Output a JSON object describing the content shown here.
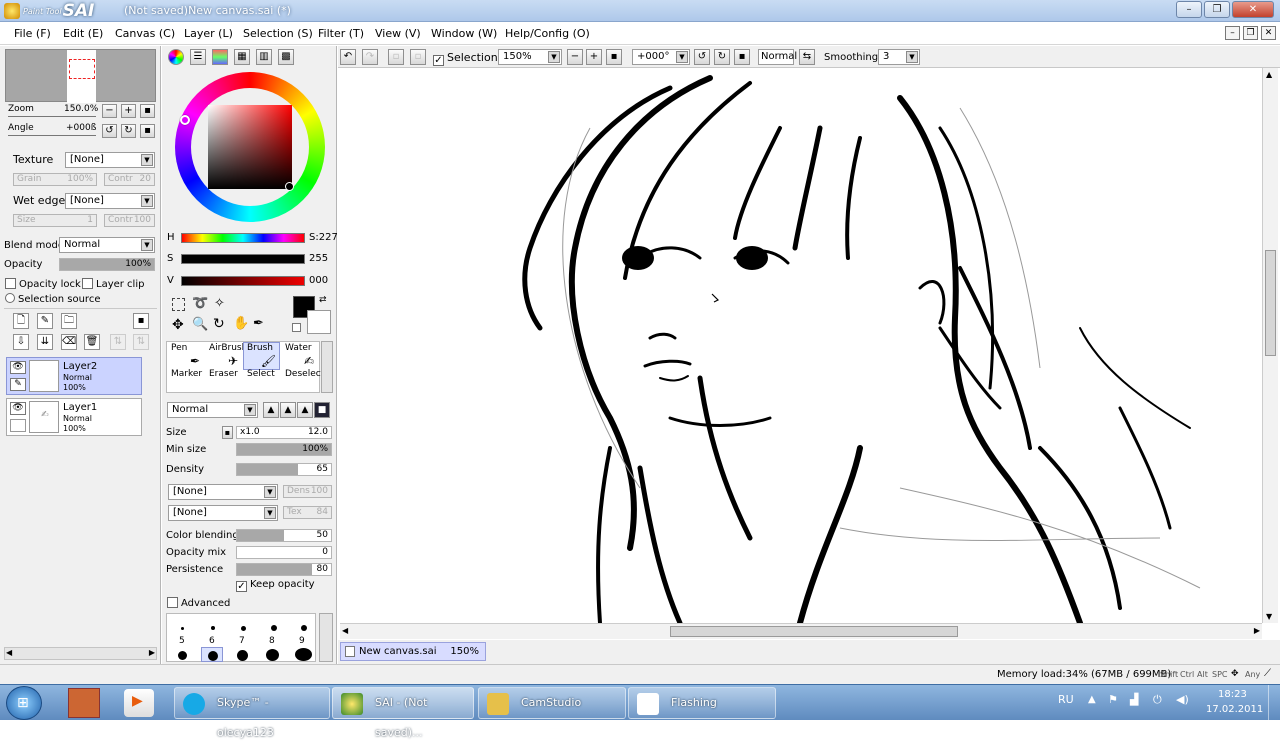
{
  "window": {
    "logo_small": "Paint Tool",
    "logo_big": "SAI",
    "title": "(Not saved)New canvas.sai (*)",
    "controls": [
      "–",
      "❐",
      "✕"
    ]
  },
  "menu": [
    {
      "label": "File (F)"
    },
    {
      "label": "Edit (E)"
    },
    {
      "label": "Canvas (C)"
    },
    {
      "label": "Layer (L)"
    },
    {
      "label": "Selection (S)"
    },
    {
      "label": "Filter (T)"
    },
    {
      "label": "View (V)"
    },
    {
      "label": "Window (W)"
    },
    {
      "label": "Help/Config (O)"
    }
  ],
  "navigator": {
    "zoom_label": "Zoom",
    "zoom_value": "150.0%",
    "angle_label": "Angle",
    "angle_value": "+000ß"
  },
  "left": {
    "texture_label": "Texture",
    "texture_value": "[None]",
    "grain_label": "Grain",
    "grain_value": "100%",
    "contr_label": "Contr",
    "contr_value": "20",
    "wet_label": "Wet edge",
    "wet_value": "[None]",
    "size_label": "Size",
    "size_value": "1",
    "contr2_label": "Contr",
    "contr2_value": "100",
    "blend_label": "Blend mode",
    "blend_value": "Normal",
    "opacity_label": "Opacity",
    "opacity_value": "100%",
    "opacity_fraction": 1.0,
    "opacity_lock": "Opacity lock",
    "layer_clip": "Layer clip",
    "selection_source": "Selection source"
  },
  "layers": [
    {
      "name": "Layer2",
      "mode": "Normal",
      "opacity": "100%",
      "selected": true
    },
    {
      "name": "Layer1",
      "mode": "Normal",
      "opacity": "100%",
      "selected": false
    }
  ],
  "color": {
    "h_label": "H",
    "h_value": "S:227",
    "s_label": "S",
    "s_value": "255",
    "v_label": "V",
    "v_value": "000",
    "current": "#000000",
    "secondary": "#ffffff",
    "hue": "#ff0000"
  },
  "tools": [
    {
      "label": "Pen",
      "active": false
    },
    {
      "label": "AirBrush",
      "active": false
    },
    {
      "label": "Brush",
      "active": true
    },
    {
      "label": "Water",
      "active": false
    },
    {
      "label": "Marker",
      "active": false
    },
    {
      "label": "Eraser",
      "active": false
    },
    {
      "label": "Select",
      "active": false
    },
    {
      "label": "Deselect",
      "active": false
    }
  ],
  "brush": {
    "mode": "Normal",
    "size_label": "Size",
    "size_mult": "x1.0",
    "size_value": "12.0",
    "minsize_label": "Min size",
    "minsize_value": "100%",
    "minsize_fraction": 1.0,
    "density_label": "Density",
    "density_value": "65",
    "density_fraction": 0.65,
    "tex1": "[None]",
    "tex1_dim_label": "Dens",
    "tex1_dim_value": "100",
    "tex2": "[None]",
    "tex2_dim_label": "Tex",
    "tex2_dim_value": "84",
    "blending_label": "Color blending",
    "blending_value": "50",
    "blending_fraction": 0.5,
    "opmix_label": "Opacity mix",
    "opmix_value": "0",
    "opmix_fraction": 0.0,
    "persist_label": "Persistence",
    "persist_value": "80",
    "persist_fraction": 0.8,
    "keep_opacity": "Keep opacity",
    "advanced": "Advanced",
    "brush_sizes": [
      "5",
      "6",
      "7",
      "8",
      "9"
    ]
  },
  "canvas_toolbar": {
    "selection_label": "Selection",
    "zoom": "150%",
    "angle": "+000°",
    "blend": "Normal",
    "smoothing_label": "Smoothing",
    "smoothing_value": "3"
  },
  "doc_tab": {
    "name": "New canvas.sai",
    "zoom": "150%"
  },
  "status": {
    "memory": "Memory load:34% (67MB / 699MB)",
    "keys": [
      "Shift",
      "Ctrl",
      "Alt",
      "SPC",
      "Any"
    ]
  },
  "taskbar": {
    "items": [
      {
        "label": "Skype™ - olecya123",
        "active": false
      },
      {
        "label": "SAI - (Not saved)...",
        "active": true
      },
      {
        "label": "CamStudio",
        "active": false
      },
      {
        "label": "Flashing",
        "active": false
      }
    ],
    "lang": "RU",
    "time": "18:23",
    "date": "17.02.2011"
  }
}
